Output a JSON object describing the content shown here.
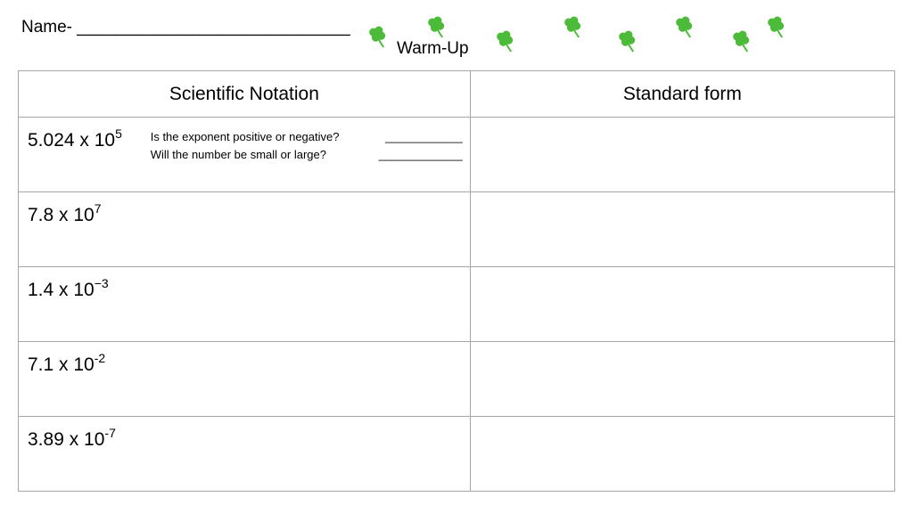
{
  "header": {
    "name_label": "Name- _____________________________",
    "title": "Warm-Up",
    "clover_color": "#4cbb3a",
    "clover_icon": "four-leaf-clover-icon"
  },
  "table": {
    "headers": [
      "Scientific Notation",
      "Standard form"
    ],
    "rows": [
      {
        "coefficient": "5.024 x 10",
        "exponent": "5",
        "standard_form": ""
      },
      {
        "coefficient": "7.8 x 10",
        "exponent": "7",
        "standard_form": ""
      },
      {
        "coefficient": "1.4 x 10",
        "exponent": "−3",
        "standard_form": ""
      },
      {
        "coefficient": "7.1 x 10",
        "exponent": "-2",
        "standard_form": ""
      },
      {
        "coefficient": "3.89 x 10",
        "exponent": "-7",
        "standard_form": ""
      }
    ],
    "hints": {
      "q1": "Is the exponent positive or negative?",
      "q1_blank": "____________",
      "q2": "Will the number be small or large?",
      "q2_blank": "_____________"
    }
  }
}
